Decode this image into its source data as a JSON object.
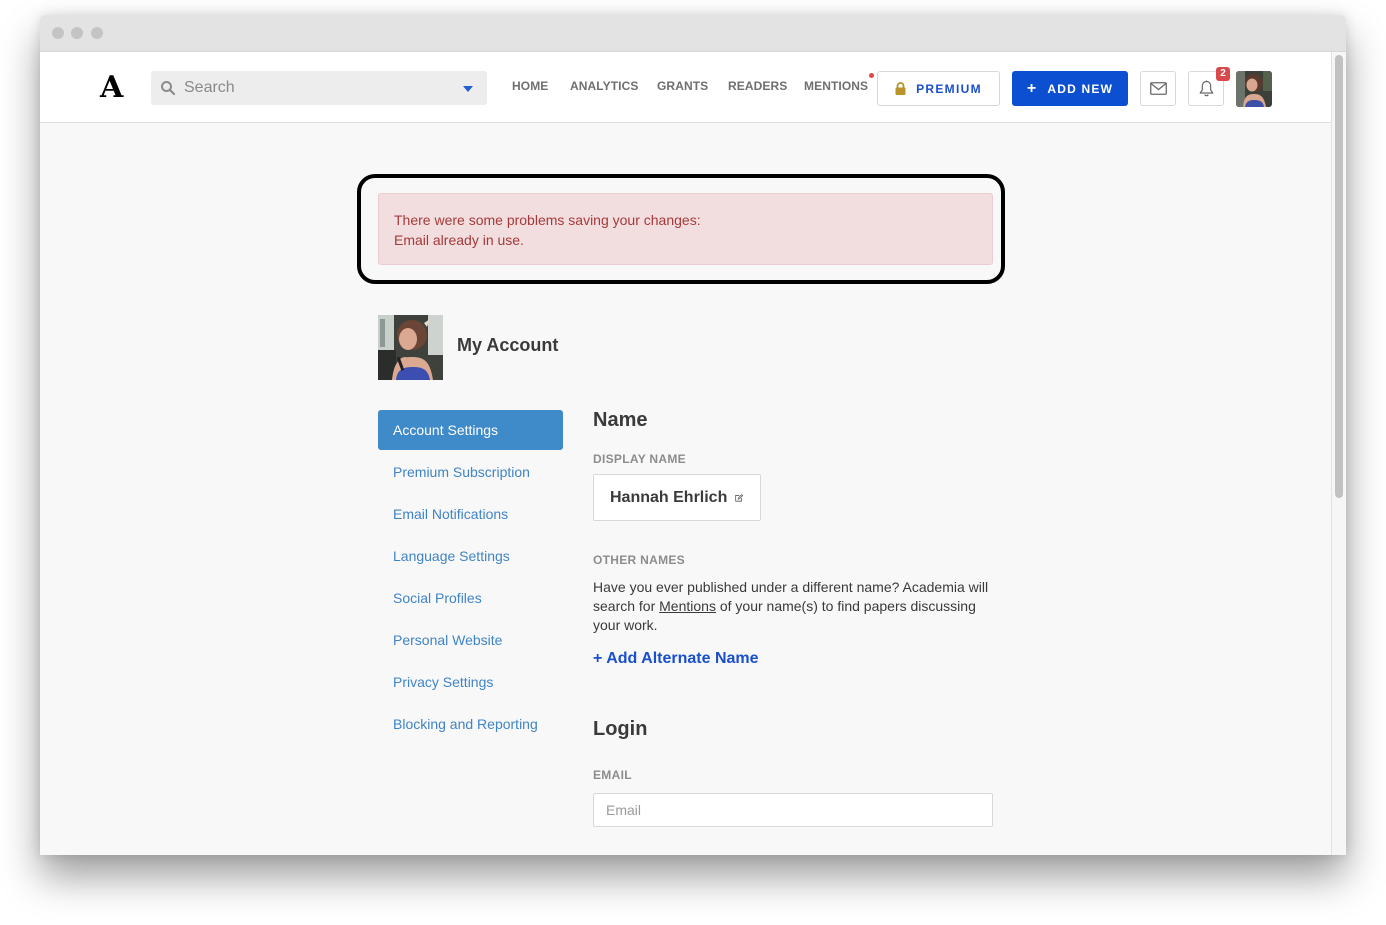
{
  "header": {
    "logo": "A",
    "search": {
      "placeholder": "Search",
      "value": ""
    },
    "nav": [
      {
        "label": "HOME"
      },
      {
        "label": "ANALYTICS"
      },
      {
        "label": "GRANTS"
      },
      {
        "label": "READERS"
      },
      {
        "label": "MENTIONS",
        "has_dot": true
      }
    ],
    "premium_label": "PREMIUM",
    "add_new_label": "ADD NEW",
    "add_new_icon": "+",
    "notifications_count": "2",
    "colors": {
      "brand_blue": "#0c4fd1",
      "premium_lock": "#b8942a",
      "badge_red": "#d9484a"
    }
  },
  "alert": {
    "line1": "There were some problems saving your changes:",
    "line2": "Email already in use.",
    "colors": {
      "bg": "#f2dedf",
      "text": "#a63a3a"
    }
  },
  "account": {
    "title": "My Account"
  },
  "sidebar": {
    "items": [
      {
        "label": "Account Settings",
        "active": true
      },
      {
        "label": "Premium Subscription"
      },
      {
        "label": "Email Notifications"
      },
      {
        "label": "Language Settings"
      },
      {
        "label": "Social Profiles"
      },
      {
        "label": "Personal Website"
      },
      {
        "label": "Privacy Settings"
      },
      {
        "label": "Blocking and Reporting"
      }
    ]
  },
  "name_section": {
    "heading": "Name",
    "display_name_label": "DISPLAY NAME",
    "display_name_value": "Hannah Ehrlich",
    "other_names_label": "OTHER NAMES",
    "other_names_text_before": "Have you ever published under a different name? Academia will search for ",
    "other_names_link": "Mentions",
    "other_names_text_after": " of your name(s) to find papers discussing your work.",
    "add_alternate_label": "+ Add Alternate Name"
  },
  "login_section": {
    "heading": "Login",
    "email_label": "EMAIL",
    "email_placeholder": "Email",
    "email_value": ""
  }
}
